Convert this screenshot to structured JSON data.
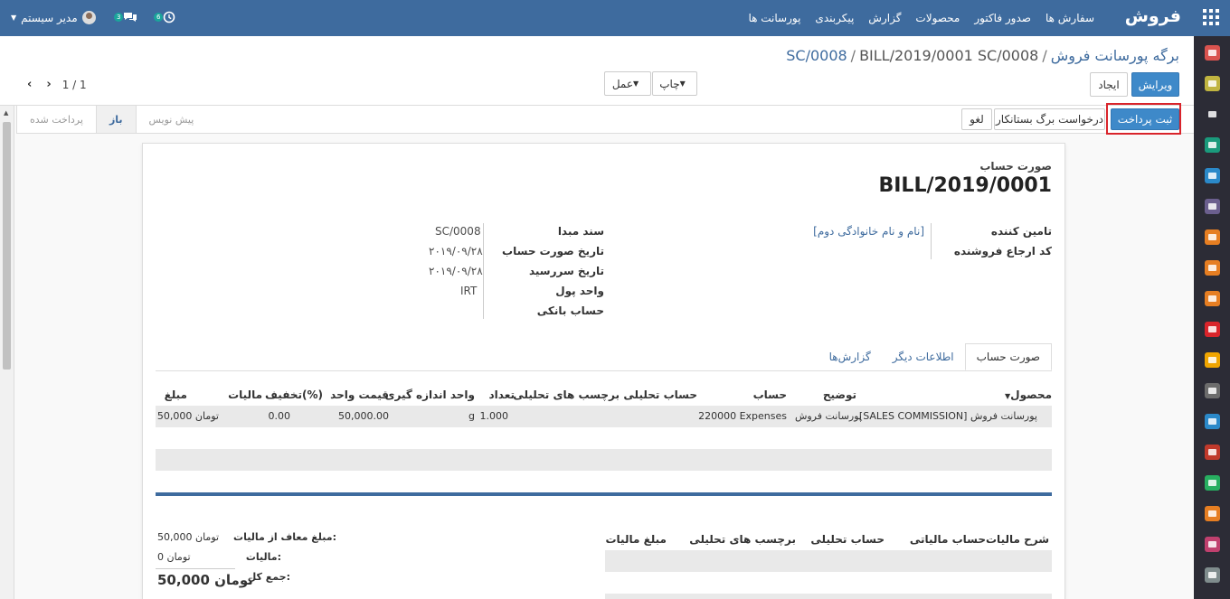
{
  "navbar": {
    "brand": "فروش",
    "menu": [
      "سفارش ها",
      "صدور فاکتور",
      "محصولات",
      "گزارش",
      "پیکربندی",
      "پورسانت ها"
    ],
    "user": "مدیر سیستم",
    "activity_count": "6",
    "messages_count": "3"
  },
  "breadcrumb": {
    "root": "برگه پورسانت فروش",
    "parent": "SC/0008",
    "current": "BILL/2019/0001 SC/0008",
    "sep": "/"
  },
  "buttons": {
    "edit": "ویرایش",
    "create": "ایجاد",
    "print": "چاپ",
    "action": "عمل",
    "register_payment": "ثبت پرداخت",
    "refund": "درخواست برگ بستانکار",
    "cancel": "لغو"
  },
  "pager": {
    "value": "1 / 1"
  },
  "status": {
    "draft": "پیش نویس",
    "open": "باز",
    "paid": "پرداخت شده"
  },
  "doc": {
    "type_label": "صورت حساب",
    "name": "BILL/2019/0001",
    "vendor_label": "تامین کننده",
    "vendor_value": "[نام و نام خانوادگی دوم]",
    "vendor_ref_label": "کد ارجاع فروشنده",
    "source_label": "سند مبدا",
    "source_value": "SC/0008",
    "bill_date_label": "تاریخ صورت حساب",
    "bill_date_value": "۲۰۱۹/۰۹/۲۸",
    "due_date_label": "تاریخ سررسید",
    "due_date_value": "۲۰۱۹/۰۹/۲۸",
    "currency_label": "واحد پول",
    "currency_value": "IRT",
    "bank_label": "حساب بانکی"
  },
  "tabs": [
    "صورت حساب",
    "اطلاعات دیگر",
    "گزارش‌ها"
  ],
  "lines": {
    "headers": {
      "product": "محصول",
      "description": "توضیح",
      "account": "حساب",
      "analytic_account": "حساب تحلیلی",
      "analytic_tags": "برچسب های تحلیلی",
      "quantity": "تعداد",
      "uom": "واحد اندازه گیری",
      "unit_price": "قیمت واحد",
      "discount": "تخفیف(%)",
      "taxes": "مالیات",
      "amount": "مبلغ"
    },
    "rows": [
      {
        "product": "[SALES COMMISSION] پورسانت فروش",
        "description": "پورسانت فروش",
        "account": "220000 Expenses",
        "quantity": "1.000",
        "uom": "g",
        "unit_price": "50,000.00",
        "discount": "0.00",
        "amount": "50,000 تومان"
      }
    ]
  },
  "tax_table": {
    "headers": {
      "description": "شرح مالیات",
      "tax_account": "حساب مالیاتی",
      "analytic_account": "حساب تحلیلی",
      "analytic_tags": "برچسب های تحلیلی",
      "amount": "مبلغ مالیات"
    }
  },
  "totals": {
    "untaxed_label": "مبلغ معاف از مالیات:",
    "untaxed_value": "50,000 تومان",
    "tax_label": "مالیات:",
    "tax_value": "0 تومان",
    "total_label": "جمع کل:",
    "total_value": "50,000 تومان"
  },
  "colors": {
    "navbar": "#3e6b9e",
    "primary": "#3e89c9",
    "highlight": "#d9242b",
    "sidebar": "#2c2c36"
  },
  "sidebar_icons": [
    {
      "name": "discuss-icon",
      "color": "#d9534f"
    },
    {
      "name": "calendar-icon",
      "color": "#c0b440"
    },
    {
      "name": "notes-icon",
      "color": "#2c2c36"
    },
    {
      "name": "project-icon",
      "color": "#1a9a7c"
    },
    {
      "name": "settings-gear-icon",
      "color": "#2b89c9"
    },
    {
      "name": "crm-handshake-icon",
      "color": "#6b5f8e"
    },
    {
      "name": "sales-chart-icon",
      "color": "#e67e22"
    },
    {
      "name": "website-globe-icon",
      "color": "#e67e22"
    },
    {
      "name": "invoicing-icon",
      "color": "#e67e22"
    },
    {
      "name": "documents-folder-icon",
      "color": "#d9242b"
    },
    {
      "name": "helpdesk-icon",
      "color": "#f0a500"
    },
    {
      "name": "inventory-icon",
      "color": "#6c6c6c"
    },
    {
      "name": "payment-card-icon",
      "color": "#2b89c9"
    },
    {
      "name": "gift-icon",
      "color": "#c0392b"
    },
    {
      "name": "tools-icon",
      "color": "#27ae60"
    },
    {
      "name": "report-icon",
      "color": "#e67e22"
    },
    {
      "name": "employees-icon",
      "color": "#c0406e"
    },
    {
      "name": "apps-puzzle-icon",
      "color": "#7f8c8d"
    }
  ]
}
